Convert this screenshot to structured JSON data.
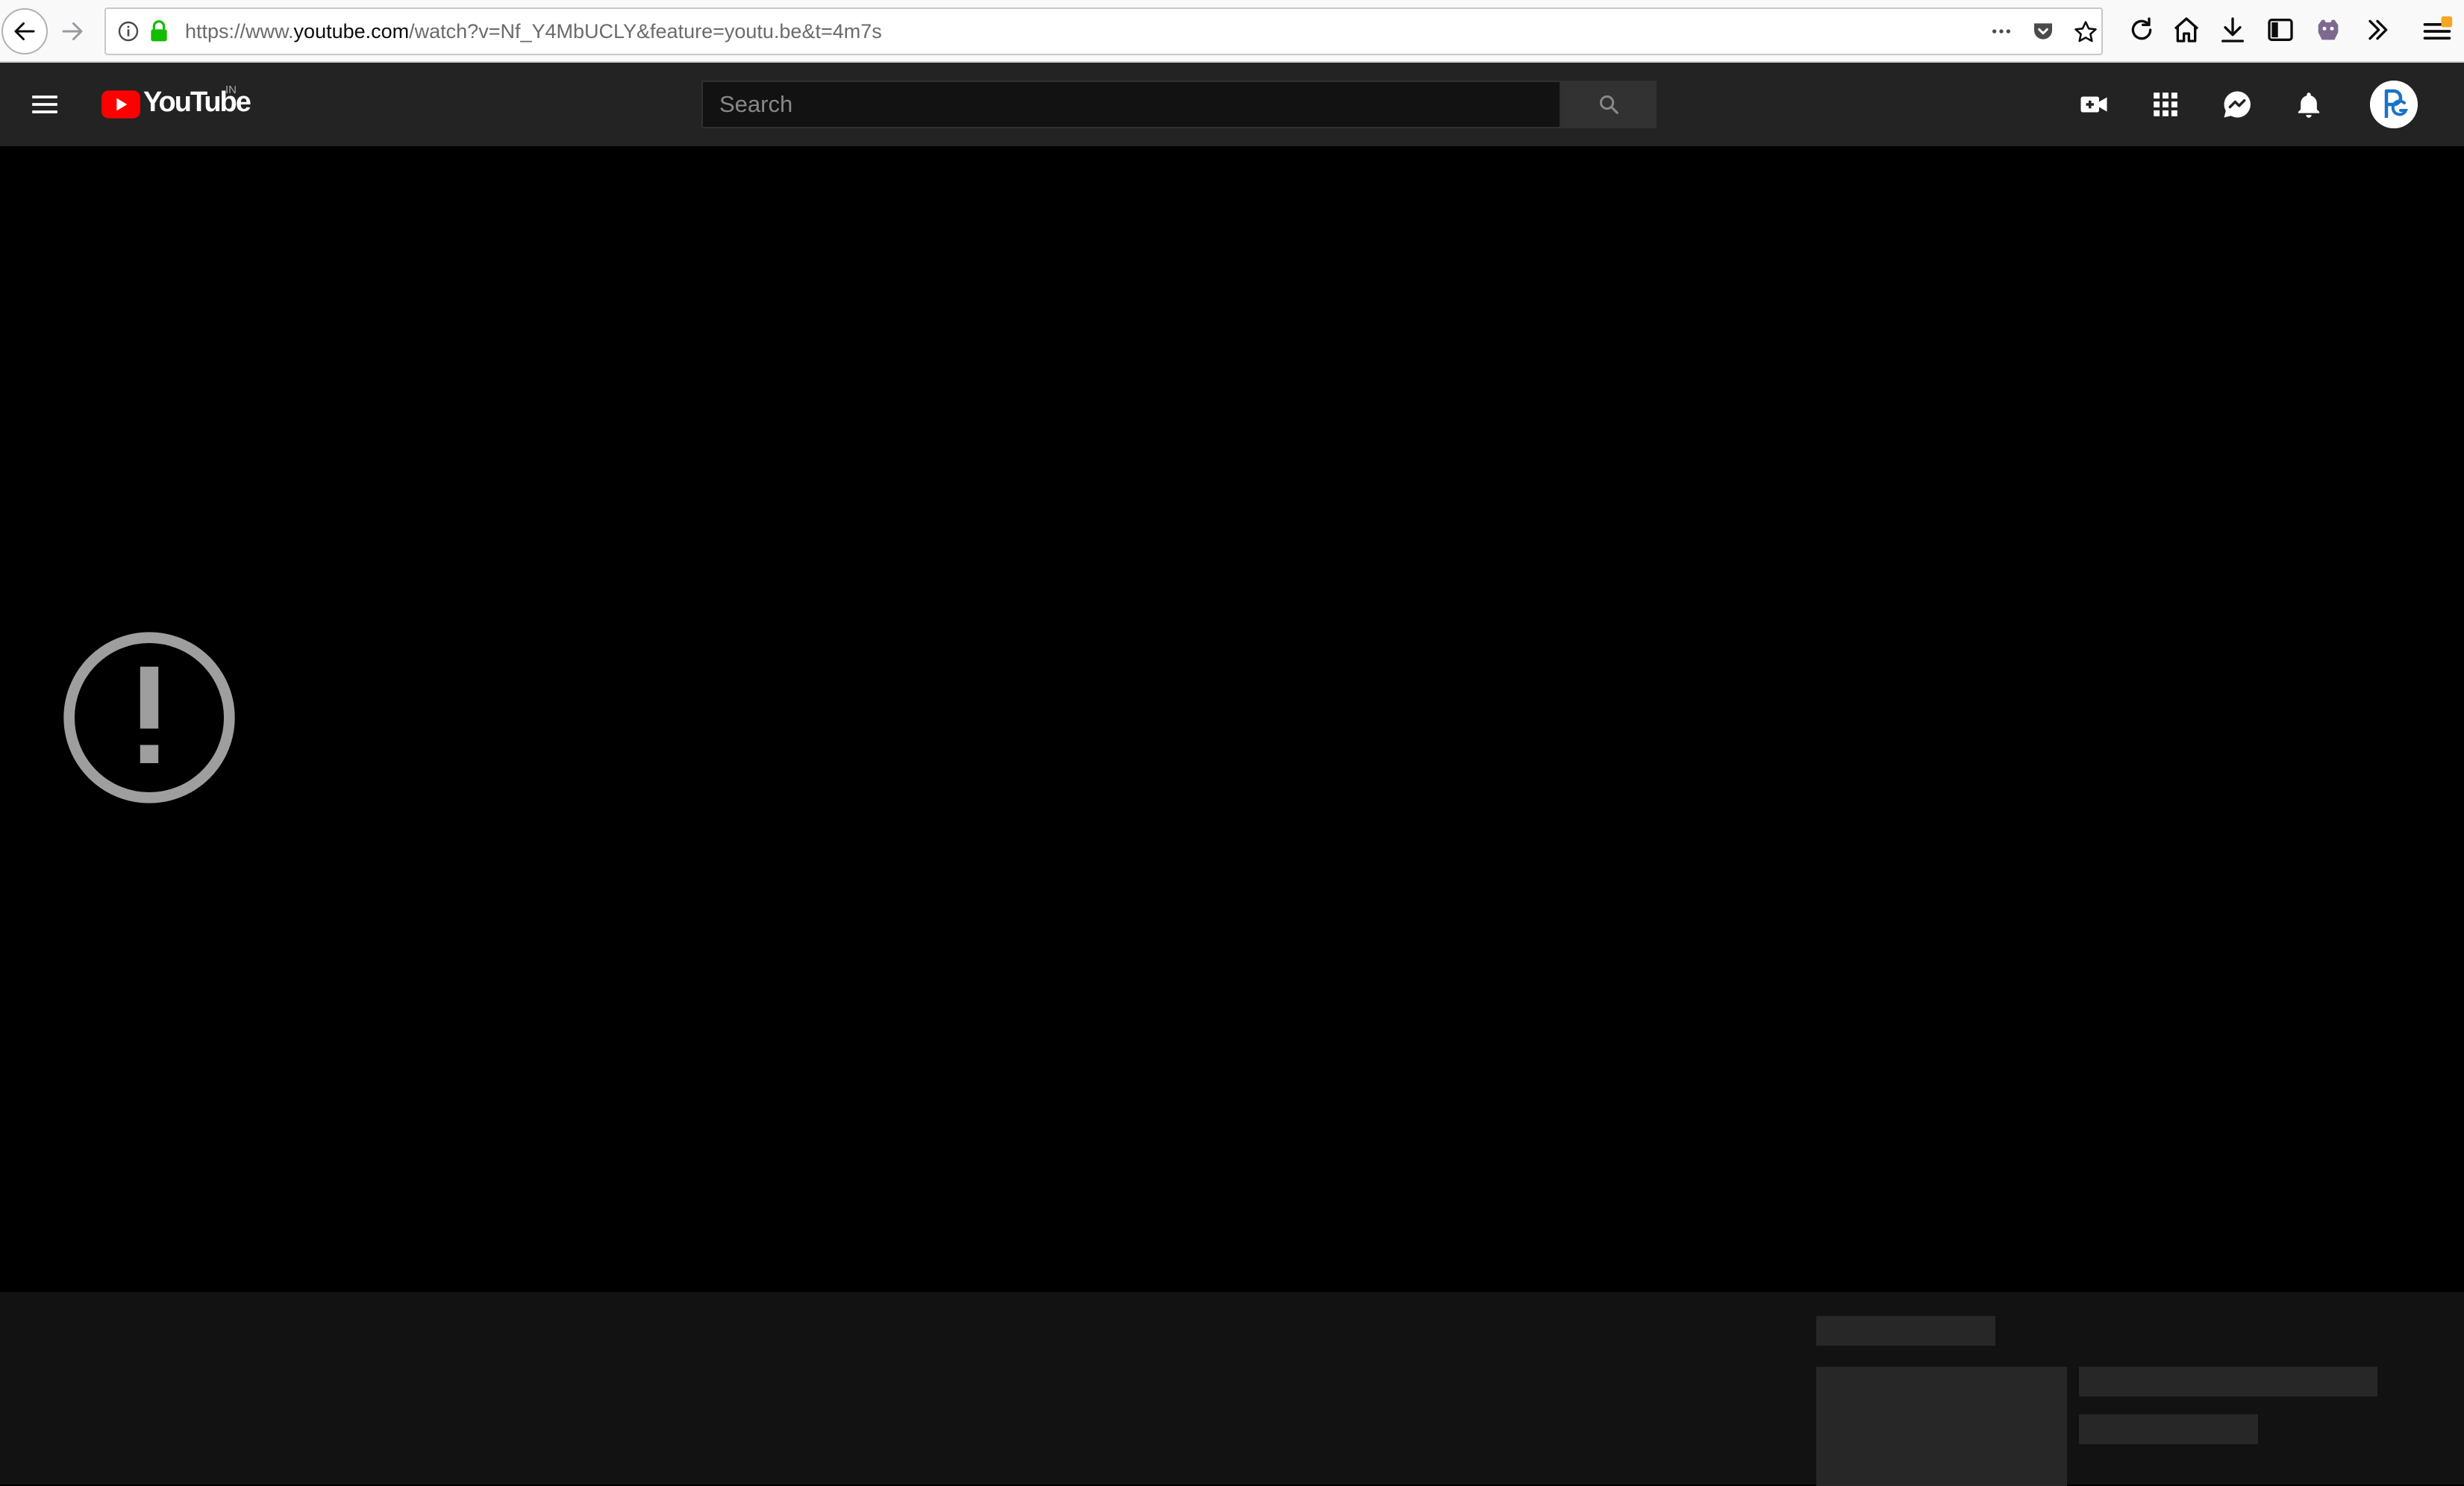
{
  "browser": {
    "url_prefix": "https://www.",
    "url_domain": "youtube.com",
    "url_path": "/watch?v=Nf_Y4MbUCLY&feature=youtu.be&t=4m7s",
    "more_icon": "ellipsis-icon",
    "icons": [
      "back-icon",
      "forward-icon",
      "info-icon",
      "lock-icon",
      "pocket-icon",
      "star-icon",
      "reload-icon",
      "home-icon",
      "download-icon",
      "sidebar-icon",
      "extension-icon",
      "overflow-icon",
      "menu-icon"
    ]
  },
  "header": {
    "logo_text": "YouTube",
    "country_code": "IN",
    "search": {
      "placeholder": "Search",
      "value": ""
    },
    "icons": [
      "create-video-icon",
      "apps-grid-icon",
      "messages-icon",
      "notifications-icon"
    ],
    "avatar_initials": "PG"
  },
  "player": {
    "state": "error",
    "icon": "error-exclamation-icon"
  },
  "colors": {
    "header_bg": "#232323",
    "player_bg": "#000000",
    "page_bg": "#121212",
    "placeholder": "#272727",
    "youtube_red": "#FF0000",
    "lock_green": "#12BC00"
  }
}
